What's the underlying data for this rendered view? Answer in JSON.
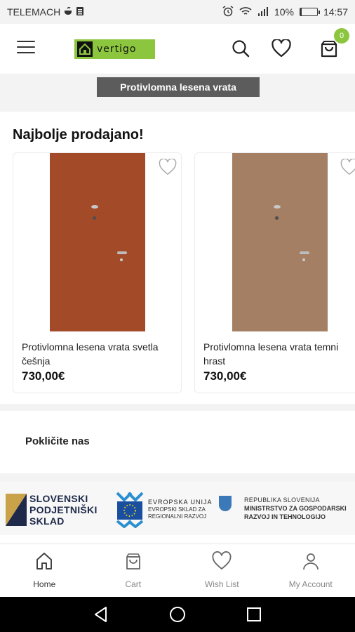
{
  "status_bar": {
    "carrier": "TELEMACH",
    "battery": "10%",
    "battery_level": 0.1,
    "time": "14:57"
  },
  "header": {
    "logo_text": "vertigo",
    "cart_count": "0"
  },
  "category_banner": "Protivlomna lesena vrata",
  "best_sellers": {
    "title": "Najbolje prodajano!",
    "products": [
      {
        "name": "Protivlomna lesena vrata svetla češnja",
        "price": "730,00€",
        "color": "#b1512d"
      },
      {
        "name": "Protivlomna lesena vrata temni hrast",
        "price": "730,00€",
        "color": "#b38a6c"
      }
    ]
  },
  "call_us": "Pokličite nas",
  "sponsors": {
    "sps": [
      "SLOVENSKI",
      "PODJETNIŠKI",
      "SKLAD"
    ],
    "eu": [
      "EVROPSKA UNIJA",
      "EVROPSKI SKLAD ZA",
      "REGIONALNI RAZVOJ"
    ],
    "rs": [
      "REPUBLIKA SLOVENIJA",
      "MINISTRSTVO ZA GOSPODARSKI",
      "RAZVOJ IN TEHNOLOGIJO"
    ]
  },
  "bottom_nav": [
    {
      "label": "Home",
      "icon": "home-icon"
    },
    {
      "label": "Cart",
      "icon": "bag-icon"
    },
    {
      "label": "Wish List",
      "icon": "heart-icon"
    },
    {
      "label": "My Account",
      "icon": "user-icon"
    }
  ],
  "colors": {
    "accent": "#8cc63f",
    "banner": "#5c5c5c"
  }
}
